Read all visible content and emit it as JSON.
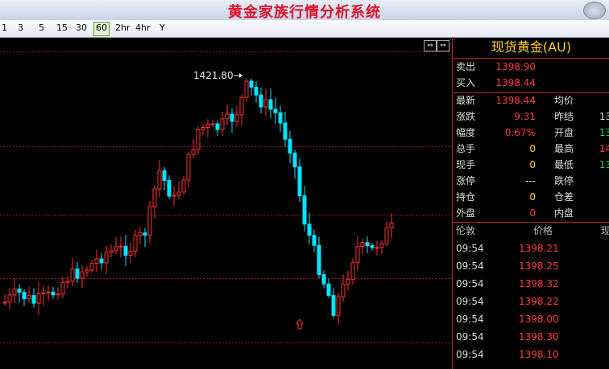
{
  "window": {
    "title": "黄金家族行情分析系统"
  },
  "toolbar": {
    "periods": [
      "1",
      "3",
      "5",
      "15",
      "30",
      "60",
      "2hr",
      "4hr",
      "Y"
    ],
    "active": "60"
  },
  "chart": {
    "high_label": "1421.80",
    "up_color": "#ff3030",
    "down_color": "#00e5ff"
  },
  "panel": {
    "title": "现货黄金(AU)",
    "sell": {
      "label": "卖出",
      "value": "1398.90"
    },
    "buy": {
      "label": "买入",
      "value": "1398.44"
    },
    "left_rows": [
      {
        "label": "最新",
        "value": "1398.44"
      },
      {
        "label": "涨跌",
        "value": "9.31"
      },
      {
        "label": "幅度",
        "value": "0.67%"
      },
      {
        "label": "总手",
        "value": "0"
      },
      {
        "label": "现手",
        "value": "0"
      },
      {
        "label": "涨停",
        "value": "---"
      },
      {
        "label": "持仓",
        "value": "0"
      },
      {
        "label": "外盘",
        "value": "0"
      }
    ],
    "right_rows": [
      {
        "label": "均价",
        "value": ""
      },
      {
        "label": "昨结",
        "value": "13"
      },
      {
        "label": "开盘",
        "value": "13"
      },
      {
        "label": "最高",
        "value": "14"
      },
      {
        "label": "最低",
        "value": "13"
      },
      {
        "label": "跌停",
        "value": ""
      },
      {
        "label": "仓差",
        "value": ""
      },
      {
        "label": "内盘",
        "value": ""
      }
    ],
    "tick_header": {
      "time": "伦敦",
      "price": "价格",
      "vol": "现"
    },
    "ticks": [
      {
        "time": "09:54",
        "price": "1398.21"
      },
      {
        "time": "09:54",
        "price": "1398.25"
      },
      {
        "time": "09:54",
        "price": "1398.32"
      },
      {
        "time": "09:54",
        "price": "1398.22"
      },
      {
        "time": "09:54",
        "price": "1398.00"
      },
      {
        "time": "09:54",
        "price": "1398.30"
      },
      {
        "time": "09:54",
        "price": "1398.10"
      }
    ]
  }
}
